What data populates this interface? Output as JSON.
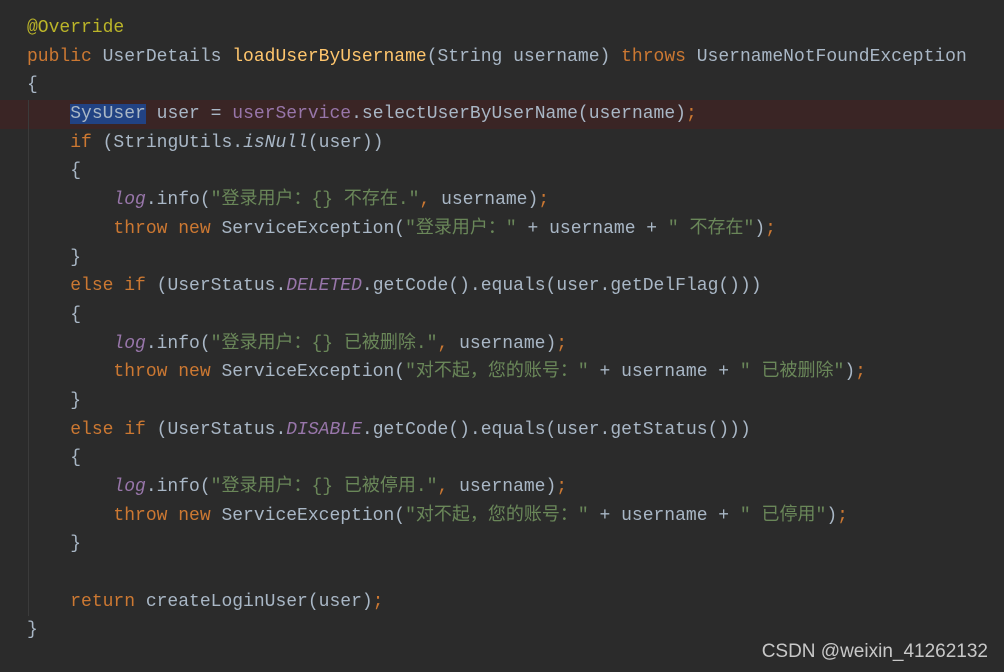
{
  "colors": {
    "background": "#2b2b2b",
    "keyword": "#cc7832",
    "annotation": "#bbb529",
    "method_declaration": "#ffc66d",
    "default": "#a9b7c6",
    "field": "#9876aa",
    "string": "#6a8759",
    "selection": "#214283",
    "highlighted_line": "#3a2525"
  },
  "code": {
    "lines": [
      {
        "indent": 0,
        "tokens": [
          [
            "@Override",
            "ann"
          ]
        ]
      },
      {
        "indent": 0,
        "tokens": [
          [
            "public",
            "kw"
          ],
          [
            " UserDetails ",
            ""
          ],
          [
            "loadUserByUsername",
            "fn"
          ],
          [
            "(String username) ",
            ""
          ],
          [
            "throws",
            "kw"
          ],
          [
            " UsernameNotFoundException",
            ""
          ]
        ]
      },
      {
        "indent": 0,
        "tokens": [
          [
            "{",
            ""
          ]
        ]
      },
      {
        "indent": 1,
        "highlight": true,
        "tokens": [
          [
            "SysUser",
            "sel"
          ],
          [
            " user = ",
            ""
          ],
          [
            "userService",
            "fld"
          ],
          [
            ".selectUserByUserName(username)",
            ""
          ],
          [
            ";",
            "kw"
          ]
        ]
      },
      {
        "indent": 1,
        "tokens": [
          [
            "if",
            "kw"
          ],
          [
            " (StringUtils.",
            ""
          ],
          [
            "isNull",
            "smth"
          ],
          [
            "(user))",
            ""
          ]
        ]
      },
      {
        "indent": 1,
        "tokens": [
          [
            "{",
            ""
          ]
        ]
      },
      {
        "indent": 2,
        "tokens": [
          [
            "log",
            "sfld"
          ],
          [
            ".info(",
            ""
          ],
          [
            "\"登录用户：{} 不存在.\"",
            "str"
          ],
          [
            ", ",
            "kw"
          ],
          [
            "username)",
            ""
          ],
          [
            ";",
            "kw"
          ]
        ]
      },
      {
        "indent": 2,
        "tokens": [
          [
            "throw new",
            "kw"
          ],
          [
            " ServiceException(",
            ""
          ],
          [
            "\"登录用户：\"",
            "str"
          ],
          [
            " + username + ",
            ""
          ],
          [
            "\" 不存在\"",
            "str"
          ],
          [
            ")",
            ""
          ],
          [
            ";",
            "kw"
          ]
        ]
      },
      {
        "indent": 1,
        "tokens": [
          [
            "}",
            ""
          ]
        ]
      },
      {
        "indent": 1,
        "tokens": [
          [
            "else if",
            "kw"
          ],
          [
            " (UserStatus.",
            ""
          ],
          [
            "DELETED",
            "sfld"
          ],
          [
            ".getCode().equals(user.getDelFlag()))",
            ""
          ]
        ]
      },
      {
        "indent": 1,
        "tokens": [
          [
            "{",
            ""
          ]
        ]
      },
      {
        "indent": 2,
        "tokens": [
          [
            "log",
            "sfld"
          ],
          [
            ".info(",
            ""
          ],
          [
            "\"登录用户：{} 已被删除.\"",
            "str"
          ],
          [
            ", ",
            "kw"
          ],
          [
            "username)",
            ""
          ],
          [
            ";",
            "kw"
          ]
        ]
      },
      {
        "indent": 2,
        "tokens": [
          [
            "throw new",
            "kw"
          ],
          [
            " ServiceException(",
            ""
          ],
          [
            "\"对不起，您的账号：\"",
            "str"
          ],
          [
            " + username + ",
            ""
          ],
          [
            "\" 已被删除\"",
            "str"
          ],
          [
            ")",
            ""
          ],
          [
            ";",
            "kw"
          ]
        ]
      },
      {
        "indent": 1,
        "tokens": [
          [
            "}",
            ""
          ]
        ]
      },
      {
        "indent": 1,
        "tokens": [
          [
            "else if",
            "kw"
          ],
          [
            " (UserStatus.",
            ""
          ],
          [
            "DISABLE",
            "sfld"
          ],
          [
            ".getCode().equals(user.getStatus()))",
            ""
          ]
        ]
      },
      {
        "indent": 1,
        "tokens": [
          [
            "{",
            ""
          ]
        ]
      },
      {
        "indent": 2,
        "tokens": [
          [
            "log",
            "sfld"
          ],
          [
            ".info(",
            ""
          ],
          [
            "\"登录用户：{} 已被停用.\"",
            "str"
          ],
          [
            ", ",
            "kw"
          ],
          [
            "username)",
            ""
          ],
          [
            ";",
            "kw"
          ]
        ]
      },
      {
        "indent": 2,
        "tokens": [
          [
            "throw new",
            "kw"
          ],
          [
            " ServiceException(",
            ""
          ],
          [
            "\"对不起，您的账号：\"",
            "str"
          ],
          [
            " + username + ",
            ""
          ],
          [
            "\" 已停用\"",
            "str"
          ],
          [
            ")",
            ""
          ],
          [
            ";",
            "kw"
          ]
        ]
      },
      {
        "indent": 1,
        "tokens": [
          [
            "}",
            ""
          ]
        ]
      },
      {
        "indent": 0,
        "tokens": []
      },
      {
        "indent": 1,
        "tokens": [
          [
            "return",
            "kw"
          ],
          [
            " createLoginUser(user)",
            ""
          ],
          [
            ";",
            "kw"
          ]
        ]
      },
      {
        "indent": 0,
        "tokens": [
          [
            "}",
            ""
          ]
        ]
      }
    ]
  },
  "watermark": "CSDN @weixin_41262132"
}
